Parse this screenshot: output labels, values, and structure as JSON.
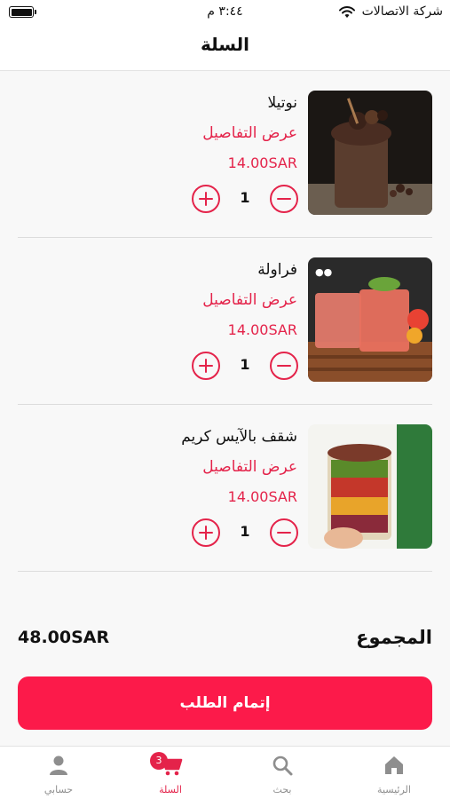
{
  "status_bar": {
    "carrier": "شركة الاتصالات",
    "time": "٣:٤٤ م"
  },
  "nav": {
    "title": "السلة"
  },
  "cart": {
    "details_label": "عرض التفاصيل",
    "items": [
      {
        "name": "نوتيلا",
        "price": "14.00SAR",
        "quantity": "1",
        "image": "chocolate-milkshake-photo"
      },
      {
        "name": "فراولة",
        "price": "14.00SAR",
        "quantity": "1",
        "image": "strawberry-juice-photo"
      },
      {
        "name": "شقف بالآيس كريم",
        "price": "14.00SAR",
        "quantity": "1",
        "image": "fruit-cup-photo"
      }
    ]
  },
  "summary": {
    "total_label": "المجموع",
    "total_value": "48.00SAR",
    "checkout_label": "إتمام الطلب"
  },
  "tab_bar": {
    "items": [
      {
        "label": "الرئيسية",
        "icon": "home-icon"
      },
      {
        "label": "بحث",
        "icon": "search-icon"
      },
      {
        "label": "السلة",
        "icon": "cart-icon",
        "badge": "3",
        "active": true
      },
      {
        "label": "حسابي",
        "icon": "user-icon"
      }
    ]
  },
  "colors": {
    "accent": "#e4234a",
    "button": "#fc1a4a"
  }
}
